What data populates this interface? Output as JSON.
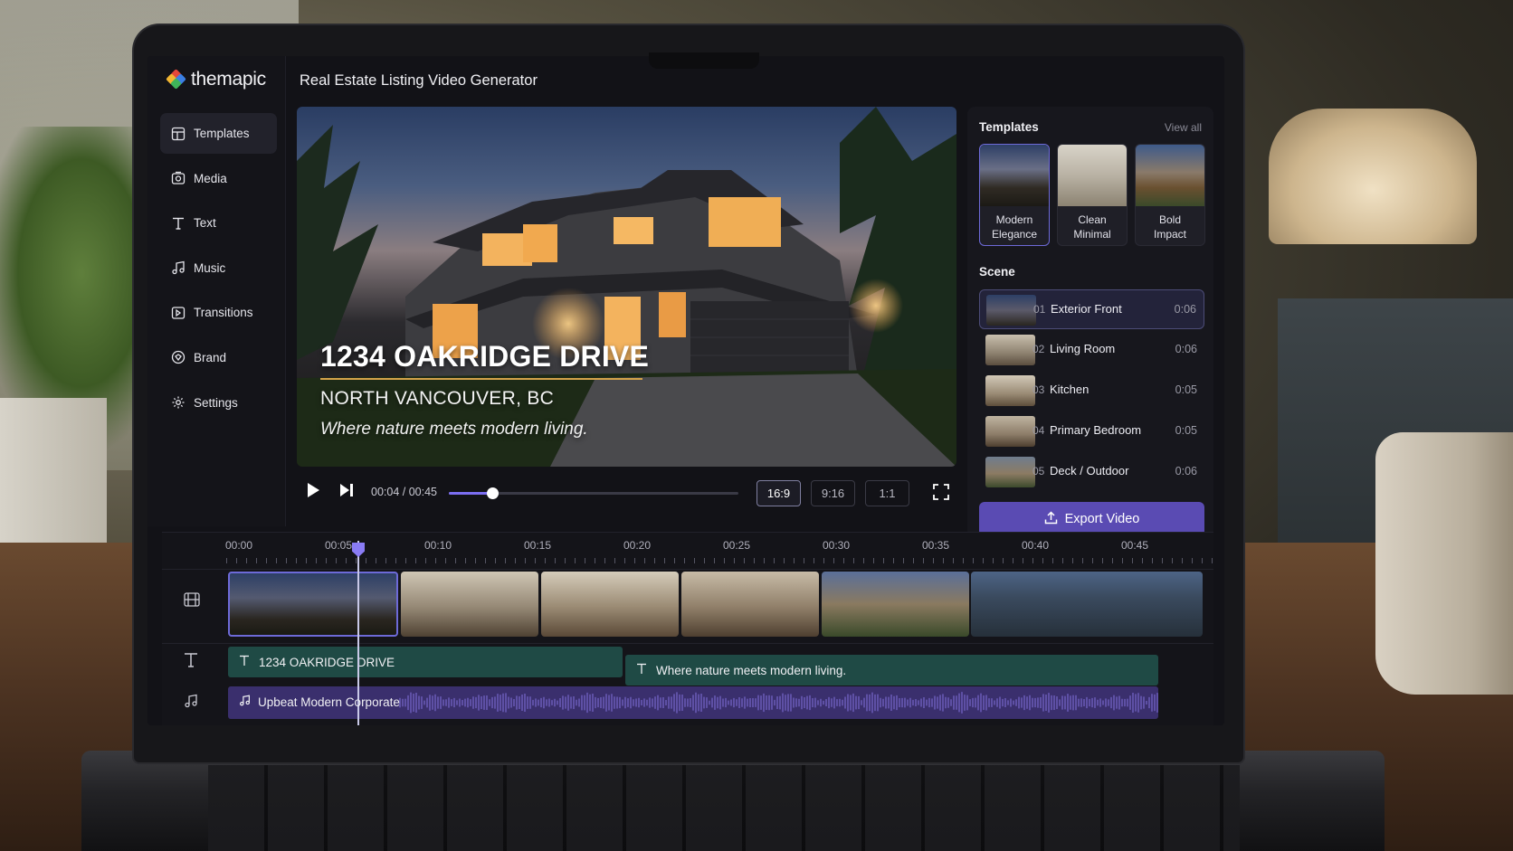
{
  "app": {
    "logo": "themapic",
    "title": "Real Estate Listing Video Generator"
  },
  "sidebar": {
    "items": [
      {
        "label": "Templates",
        "icon": "templates-icon",
        "active": true
      },
      {
        "label": "Media",
        "icon": "media-icon"
      },
      {
        "label": "Text",
        "icon": "text-icon"
      },
      {
        "label": "Music",
        "icon": "music-icon"
      },
      {
        "label": "Transitions",
        "icon": "transitions-icon"
      },
      {
        "label": "Brand",
        "icon": "brand-icon"
      },
      {
        "label": "Settings",
        "icon": "gear-icon"
      }
    ]
  },
  "preview": {
    "title": "1234 OAKRIDGE DRIVE",
    "subtitle": "NORTH VANCOUVER, BC",
    "tagline": "Where nature meets modern living."
  },
  "player": {
    "time": "00:04 / 00:45",
    "progress": 0.15,
    "ratios": [
      "16:9",
      "9:16",
      "1:1"
    ],
    "active_ratio": "16:9"
  },
  "templates": {
    "heading": "Templates",
    "view_all": "View all",
    "items": [
      {
        "line1": "Modern",
        "line2": "Elegance",
        "active": true
      },
      {
        "line1": "Clean",
        "line2": "Minimal"
      },
      {
        "line1": "Bold",
        "line2": "Impact"
      }
    ]
  },
  "scenes": {
    "heading": "Scene",
    "items": [
      {
        "num": "01",
        "name": "Exterior Front",
        "duration": "0:06",
        "active": true
      },
      {
        "num": "02",
        "name": "Living Room",
        "duration": "0:06"
      },
      {
        "num": "03",
        "name": "Kitchen",
        "duration": "0:05"
      },
      {
        "num": "04",
        "name": "Primary Bedroom",
        "duration": "0:05"
      },
      {
        "num": "05",
        "name": "Deck / Outdoor",
        "duration": "0:06"
      }
    ]
  },
  "export_label": "Export Video",
  "timeline": {
    "ticks": [
      "00:00",
      "00:05",
      "00:10",
      "00:15",
      "00:20",
      "00:25",
      "00:30",
      "00:35",
      "00:40",
      "00:45"
    ],
    "text_clips": [
      "1234 OAKRIDGE DRIVE",
      "Where nature meets modern living."
    ],
    "audio_clip": "Upbeat Modern Corporate"
  },
  "colors": {
    "accent": "#5a4bb3",
    "text_track": "#1f4a45",
    "audio_track": "#3a2f6d",
    "title_underline": "#d4a34a"
  }
}
